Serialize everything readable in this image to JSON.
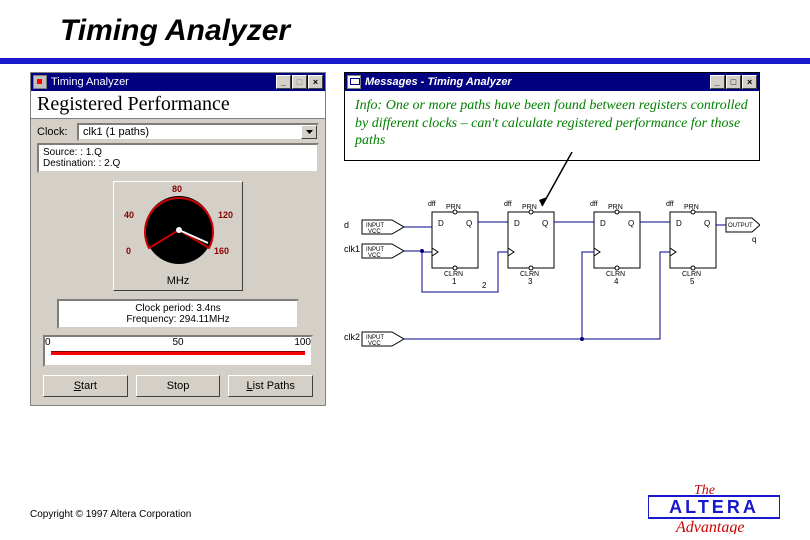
{
  "slide": {
    "title": "Timing Analyzer"
  },
  "left": {
    "window_title": "Timing Analyzer",
    "section_title": "Registered Performance",
    "clock_label": "Clock:",
    "clock_value": "clk1 (1 paths)",
    "source_line": "Source: : 1.Q",
    "dest_line": "Destination: : 2.Q",
    "gauge": {
      "unit": "MHz",
      "t0": "0",
      "t40": "40",
      "t80": "80",
      "t120": "120",
      "t160": "160"
    },
    "info": {
      "clock_period": "Clock period: 3.4ns",
      "frequency": "Frequency: 294.11MHz"
    },
    "slider": {
      "min": "0",
      "mid": "50",
      "max": "100"
    },
    "buttons": {
      "start": "tart",
      "start_u": "S",
      "stop": "Stop",
      "list_u": "L",
      "list": "ist Paths"
    }
  },
  "right": {
    "window_title": "Messages - Timing Analyzer",
    "msg": "Info: One or more paths have been found between registers controlled by different clocks – can't calculate registered performance for those paths",
    "schem": {
      "d": "d",
      "clk1": "clk1",
      "clk2": "clk2",
      "input": "INPUT",
      "vcc": "VCC",
      "output": "OUTPUT",
      "dff": "dff",
      "prn": "PRN",
      "clrn": "CLRN",
      "D": "D",
      "Q": "Q",
      "n1": "1",
      "n2": "2",
      "n3": "3",
      "n4": "4",
      "n5": "5",
      "nq": "q"
    }
  },
  "footer": {
    "copyright": "Copyright © 1997 Altera Corporation"
  },
  "logo": {
    "the": "The",
    "brand": "ALTERA",
    "slogan": "Advantage"
  }
}
